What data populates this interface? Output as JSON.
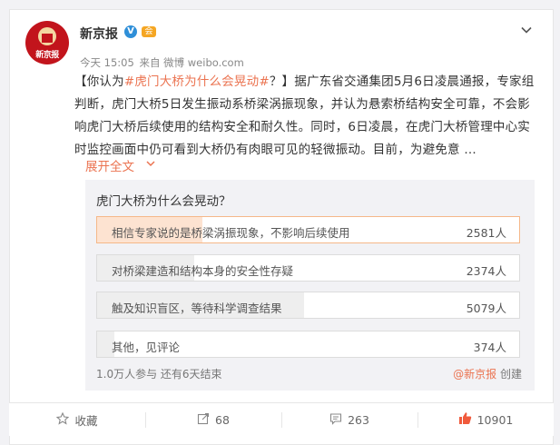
{
  "account": {
    "name": "新京报",
    "avatar_text": "新京报",
    "verified": "V",
    "member_badge": "会"
  },
  "meta": {
    "time": "今天 15:05",
    "source": "来自 微博 weibo.com"
  },
  "post": {
    "open_bracket": "【你认为",
    "hashtag": "#虎门大桥为什么会晃动#",
    "body": "？】据广东省交通集团5月6日凌晨通报，专家组判断，虎门大桥5日发生振动系桥梁涡振现象，并认为悬索桥结构安全可靠，不会影响虎门大桥后续使用的结构安全和耐久性。同时，6日凌晨，在虎门大桥管理中心实时监控画面中仍可看到大桥仍有肉眼可见的轻微振动。目前，为避免意 …",
    "expand": "展开全文"
  },
  "poll": {
    "title": "虎门大桥为什么会晃动？",
    "options": [
      {
        "label": "相信专家说的是桥梁涡振现象，不影响后续使用",
        "count": "2581人",
        "fill": 0.25
      },
      {
        "label": "对桥梁建造和结构本身的安全性存疑",
        "count": "2374人",
        "fill": 0.23
      },
      {
        "label": "触及知识盲区，等待科学调查结果",
        "count": "5079人",
        "fill": 0.49
      },
      {
        "label": "其他，见评论",
        "count": "374人",
        "fill": 0.04
      }
    ],
    "footer": "1.0万人参与 还有6天结束",
    "creator_link": "@新京报",
    "creator_suffix": " 创建"
  },
  "actions": {
    "favorite": "收藏",
    "repost": "68",
    "comment": "263",
    "like": "10901"
  },
  "icons": [
    "chevron-down-icon",
    "star-icon",
    "repost-icon",
    "comment-icon",
    "thumbs-up-icon"
  ],
  "colors": {
    "accent": "#eb7350",
    "selected_fill": "#fde3d1",
    "selected_border": "#f5b889"
  }
}
